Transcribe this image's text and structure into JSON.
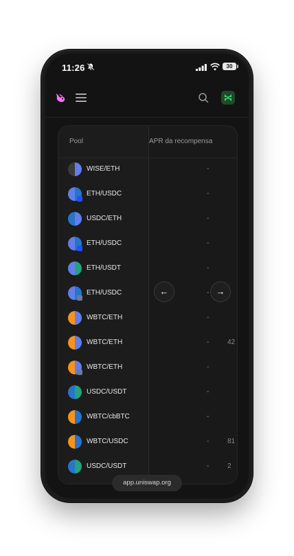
{
  "status_bar": {
    "time": "11:26",
    "battery": "30"
  },
  "table": {
    "headers": {
      "pool": "Pool",
      "apr": "APR da recompensa"
    },
    "rows": [
      {
        "name": "WISE/ETH",
        "apr": "-",
        "right": ""
      },
      {
        "name": "ETH/USDC",
        "apr": "-",
        "right": ""
      },
      {
        "name": "USDC/ETH",
        "apr": "-",
        "right": ""
      },
      {
        "name": "ETH/USDC",
        "apr": "-",
        "right": ""
      },
      {
        "name": "ETH/USDT",
        "apr": "-",
        "right": ""
      },
      {
        "name": "ETH/USDC",
        "apr": "-",
        "right": ""
      },
      {
        "name": "WBTC/ETH",
        "apr": "-",
        "right": ""
      },
      {
        "name": "WBTC/ETH",
        "apr": "-",
        "right": "42"
      },
      {
        "name": "WBTC/ETH",
        "apr": "-",
        "right": ""
      },
      {
        "name": "USDC/USDT",
        "apr": "-",
        "right": ""
      },
      {
        "name": "WBTC/cbBTC",
        "apr": "-",
        "right": ""
      },
      {
        "name": "WBTC/USDC",
        "apr": "-",
        "right": "81"
      },
      {
        "name": "USDC/USDT",
        "apr": "-",
        "right": "2"
      }
    ]
  },
  "nav": {
    "prev": "←",
    "next": "→"
  },
  "browser": {
    "url": "app.uniswap.org"
  },
  "colors": {
    "accent": "#fc72ff",
    "eth": "#627eea",
    "usdc": "#2775ca",
    "usdt": "#26a17b",
    "wbtc": "#f7931a"
  }
}
